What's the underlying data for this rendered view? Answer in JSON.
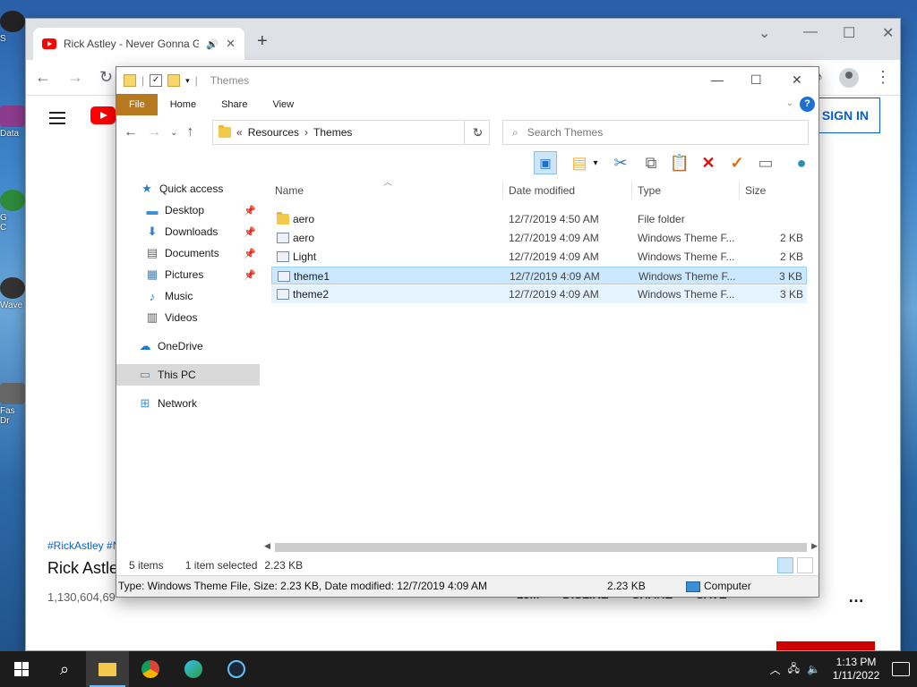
{
  "desktop": {
    "icons": [
      "S",
      "Data",
      "G\nC",
      "Wave",
      "Fas\nDr"
    ]
  },
  "browser": {
    "tab_title": "Rick Astley - Never Gonna G",
    "tab_icons": {
      "favicon": "youtube-icon",
      "audio": "speaker-icon",
      "close": "close-icon"
    },
    "new_tab": "+",
    "signin_label": "SIGN IN",
    "hashtags": "#RickAstley #N",
    "video_title": "Rick Astle",
    "views": "1,130,604,69",
    "actions": [
      "13M",
      "DISLIKE",
      "SHARE",
      "SAVE"
    ],
    "more": "…"
  },
  "explorer": {
    "title": "Themes",
    "ribbon_tabs": [
      "File",
      "Home",
      "Share",
      "View"
    ],
    "breadcrumb": {
      "prefix": "«",
      "items": [
        "Resources",
        "Themes"
      ]
    },
    "search_placeholder": "Search Themes",
    "nav_pane": [
      {
        "label": "Quick access",
        "icon": "star-icon",
        "pinned": false
      },
      {
        "label": "Desktop",
        "icon": "desktop-icon",
        "pinned": true
      },
      {
        "label": "Downloads",
        "icon": "download-icon",
        "pinned": true
      },
      {
        "label": "Documents",
        "icon": "documents-icon",
        "pinned": true
      },
      {
        "label": "Pictures",
        "icon": "pictures-icon",
        "pinned": true
      },
      {
        "label": "Music",
        "icon": "music-icon",
        "pinned": false
      },
      {
        "label": "Videos",
        "icon": "videos-icon",
        "pinned": false
      },
      {
        "label": "OneDrive",
        "icon": "cloud-icon",
        "pinned": false
      },
      {
        "label": "This PC",
        "icon": "computer-icon",
        "pinned": false
      },
      {
        "label": "Network",
        "icon": "network-icon",
        "pinned": false
      }
    ],
    "columns": [
      "Name",
      "Date modified",
      "Type",
      "Size"
    ],
    "files": [
      {
        "name": "aero",
        "date": "12/7/2019 4:50 AM",
        "type": "File folder",
        "size": "",
        "kind": "folder"
      },
      {
        "name": "aero",
        "date": "12/7/2019 4:09 AM",
        "type": "Windows Theme F...",
        "size": "2 KB",
        "kind": "theme"
      },
      {
        "name": "Light",
        "date": "12/7/2019 4:09 AM",
        "type": "Windows Theme F...",
        "size": "2 KB",
        "kind": "theme"
      },
      {
        "name": "theme1",
        "date": "12/7/2019 4:09 AM",
        "type": "Windows Theme F...",
        "size": "3 KB",
        "kind": "theme"
      },
      {
        "name": "theme2",
        "date": "12/7/2019 4:09 AM",
        "type": "Windows Theme F...",
        "size": "3 KB",
        "kind": "theme"
      }
    ],
    "status": {
      "count": "5 items",
      "selected": "1 item selected",
      "size": "2.23 KB"
    },
    "details": {
      "info": "Type: Windows Theme File, Size: 2.23 KB, Date modified: 12/7/2019 4:09 AM",
      "size": "2.23 KB",
      "location": "Computer"
    }
  },
  "taskbar": {
    "time": "1:13 PM",
    "date": "1/11/2022",
    "apps": [
      "file-explorer-icon",
      "chrome-icon",
      "edge-icon",
      "steam-icon"
    ]
  },
  "colors": {
    "accent": "#1e6fd0",
    "file_tab": "#b7791f",
    "selection": "#cce8ff",
    "youtube_red": "#ff0000"
  }
}
